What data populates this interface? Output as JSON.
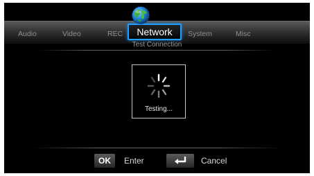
{
  "menu": {
    "items": [
      {
        "label": "Audio"
      },
      {
        "label": "Video"
      },
      {
        "label": "REC"
      },
      {
        "label": "Network",
        "active": true
      },
      {
        "label": "System"
      },
      {
        "label": "Misc"
      }
    ]
  },
  "page": {
    "subtitle": "Test Connection"
  },
  "dialog": {
    "status_text": "Testing..."
  },
  "footer": {
    "ok_key": "OK",
    "ok_label": "Enter",
    "return_key_icon": "return-arrow-icon",
    "cancel_label": "Cancel"
  },
  "colors": {
    "accent": "#1da0ff",
    "background": "#000000"
  }
}
